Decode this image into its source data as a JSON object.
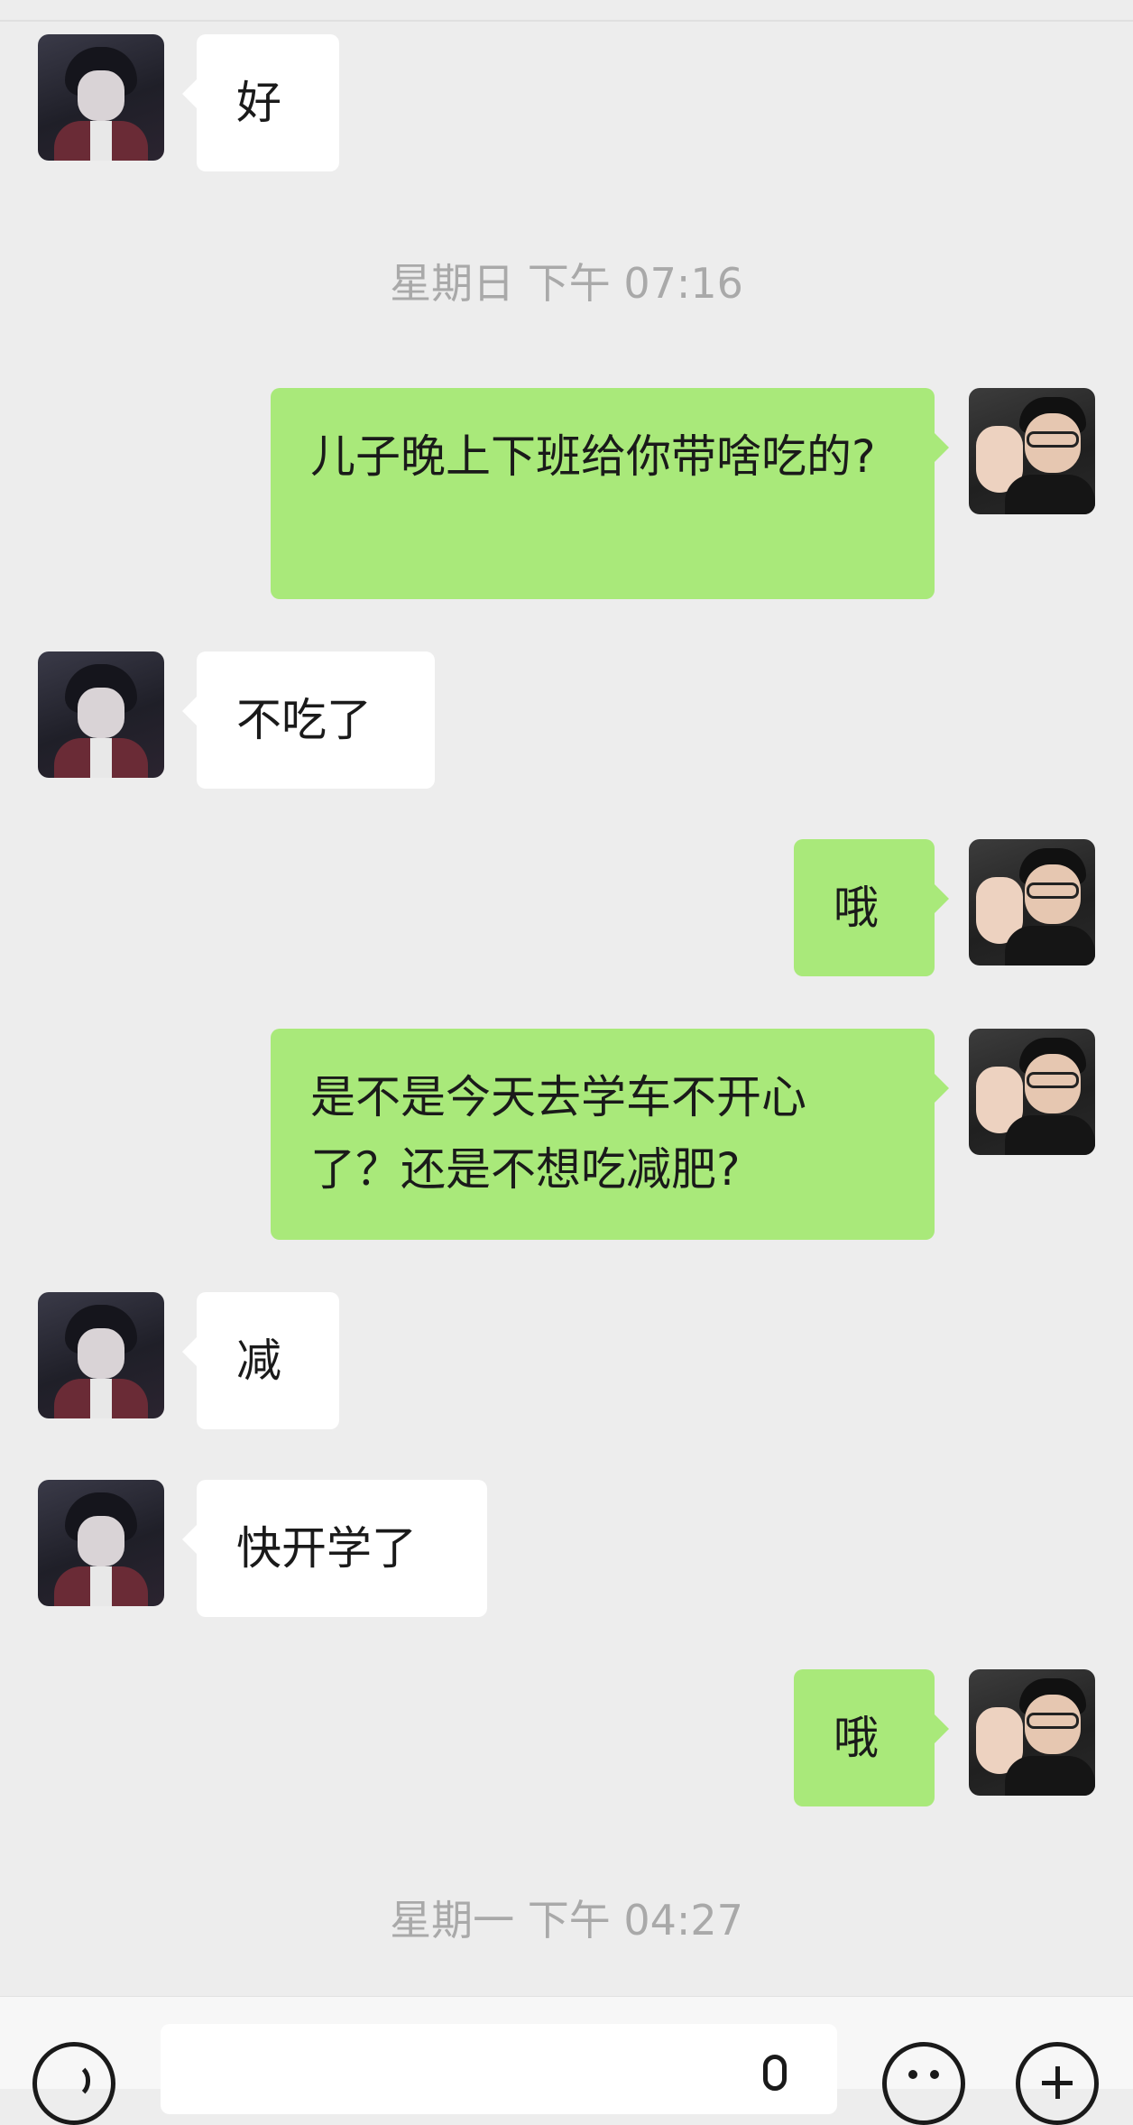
{
  "messages": [
    {
      "side": "in",
      "text": "好"
    },
    {
      "side": "out",
      "text": "儿子晚上下班给你带啥吃的?"
    },
    {
      "side": "in",
      "text": "不吃了"
    },
    {
      "side": "out",
      "text": "哦"
    },
    {
      "side": "out",
      "text": "是不是今天去学车不开心了？还是不想吃减肥?"
    },
    {
      "side": "in",
      "text": "减"
    },
    {
      "side": "in",
      "text": "快开学了"
    },
    {
      "side": "out",
      "text": "哦"
    }
  ],
  "timestamps": [
    "星期日 下午 07:16",
    "星期一 下午 04:27"
  ],
  "colors": {
    "background": "#ededed",
    "incoming_bubble": "#ffffff",
    "outgoing_bubble": "#a9e97a",
    "timestamp_text": "#a9a9a9"
  },
  "icons": {
    "voice": "voice-icon",
    "mic": "mic-icon",
    "emoji": "emoji-icon",
    "more": "plus-icon"
  }
}
